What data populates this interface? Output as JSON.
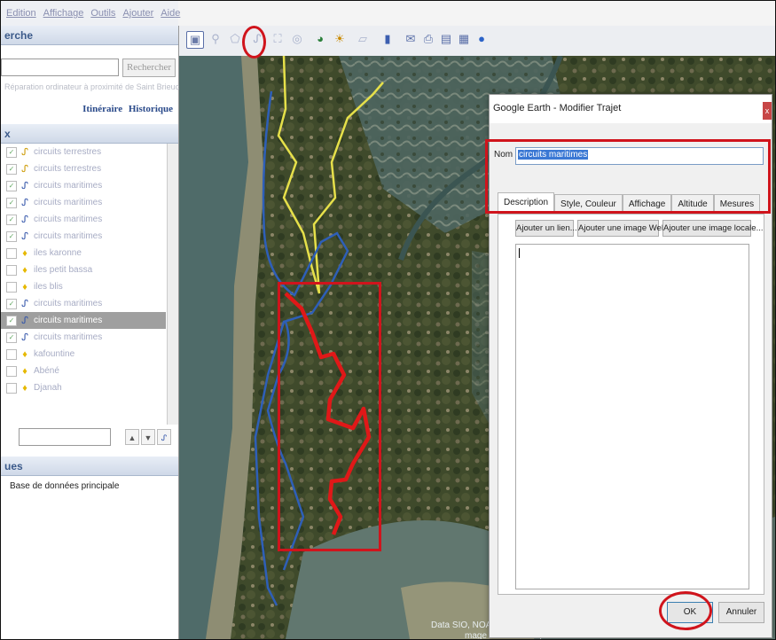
{
  "menubar": {
    "items": [
      "Edition",
      "Affichage",
      "Outils",
      "Ajouter",
      "Aide"
    ]
  },
  "search_panel": {
    "title": "erche",
    "search_button": "Rechercher",
    "hint": "Réparation ordinateur à proximité de Saint Brieuc",
    "links": {
      "itinerary": "Itinéraire",
      "history": "Historique"
    }
  },
  "places_panel": {
    "title": "x",
    "items": [
      {
        "label": "circuits terrestres",
        "icon": "land-path-icon",
        "checked": true,
        "selected": false
      },
      {
        "label": "circuits terrestres",
        "icon": "land-path-icon",
        "checked": true,
        "selected": false
      },
      {
        "label": "circuits maritimes",
        "icon": "sea-path-icon",
        "checked": true,
        "selected": false
      },
      {
        "label": "circuits maritimes",
        "icon": "sea-path-icon",
        "checked": true,
        "selected": false
      },
      {
        "label": "circuits maritimes",
        "icon": "sea-path-icon",
        "checked": true,
        "selected": false
      },
      {
        "label": "circuits maritimes",
        "icon": "sea-path-icon",
        "checked": true,
        "selected": false
      },
      {
        "label": "iles karonne",
        "icon": "pushpin-icon",
        "checked": false,
        "selected": false
      },
      {
        "label": "iles petit bassa",
        "icon": "pushpin-icon",
        "checked": false,
        "selected": false
      },
      {
        "label": "iles blis",
        "icon": "pushpin-icon",
        "checked": false,
        "selected": false
      },
      {
        "label": "circuits maritimes",
        "icon": "sea-path-icon",
        "checked": true,
        "selected": false
      },
      {
        "label": "circuits maritimes",
        "icon": "sea-path-icon",
        "checked": true,
        "selected": true
      },
      {
        "label": "circuits maritimes",
        "icon": "sea-path-icon",
        "checked": true,
        "selected": false
      },
      {
        "label": "kafountine",
        "icon": "pushpin-icon",
        "checked": false,
        "selected": false
      },
      {
        "label": "Abéné",
        "icon": "pushpin-icon",
        "checked": false,
        "selected": false
      },
      {
        "label": "Djanah",
        "icon": "pushpin-icon",
        "checked": false,
        "selected": false
      }
    ]
  },
  "layers_panel": {
    "title": "ues",
    "database": "Base de données principale"
  },
  "map": {
    "attribution_line1": "Data SIO, NOA",
    "attribution_line2": "mage Landsat / Copernicus"
  },
  "dialog": {
    "title": "Google Earth - Modifier Trajet",
    "close": "x",
    "name_label": "Nom :",
    "name_value": "circuits maritimes",
    "tabs": [
      "Description",
      "Style, Couleur",
      "Affichage",
      "Altitude",
      "Mesures"
    ],
    "active_tab": "Description",
    "buttons": {
      "add_link": "Ajouter un lien...",
      "add_web_image": "Ajouter une image Web...",
      "add_local_image": "Ajouter une image locale..."
    },
    "ok": "OK",
    "cancel": "Annuler"
  },
  "colors": {
    "annotation_red": "#d0141c",
    "sea_route_blue": "#2e5fb8",
    "land_route_yellow": "#e6e04a",
    "highlight_route_red": "#e01818"
  }
}
